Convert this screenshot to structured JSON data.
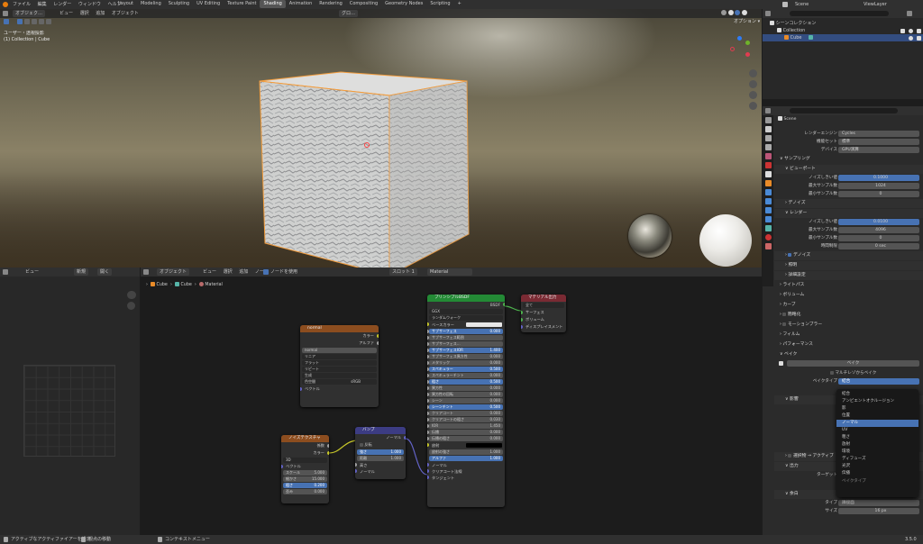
{
  "topbar": {
    "menus": [
      "ファイル",
      "編集",
      "レンダー",
      "ウィンドウ",
      "ヘルプ"
    ],
    "workspaces": [
      "Layout",
      "Modeling",
      "Sculpting",
      "UV Editing",
      "Texture Paint",
      "Shading",
      "Animation",
      "Rendering",
      "Compositing",
      "Geometry Nodes",
      "Scripting"
    ],
    "active_workspace": "Shading",
    "scene": "Scene",
    "view_layer": "ViewLayer"
  },
  "viewport": {
    "mode": "オブジェク…",
    "menus": [
      "ビュー",
      "選択",
      "追加",
      "オブジェクト"
    ],
    "transform": "グロ…",
    "overlay_label": "オプション ▾",
    "info_line1": "ユーザー・透視投影",
    "info_line2": "(1) Collection | Cube"
  },
  "image_editor": {
    "view": "ビュー",
    "new_label": "新規",
    "open_label": "開く"
  },
  "node_editor": {
    "mode": "オブジェクト",
    "menus": [
      "ビュー",
      "選択",
      "追加",
      "ノード"
    ],
    "use_nodes": "ノードを使用",
    "slot": "スロット 1",
    "material": "Material",
    "breadcrumb": [
      "Cube",
      "Cube",
      "Material"
    ]
  },
  "nodes": {
    "normal": {
      "title": "normal",
      "out_color": "カラー",
      "out_alpha": "アルファ",
      "image_name": "normal",
      "interp": "リニア",
      "proj": "フラット",
      "ext": "リピート",
      "source": "生成",
      "cs_label": "色空間",
      "cs_value": "sRGB",
      "vector": "ベクトル"
    },
    "noise": {
      "title": "ノイズテクスチャ",
      "out_fac": "係数",
      "out_color": "カラー",
      "dim": "3D",
      "vector": "ベクトル",
      "fields": [
        {
          "label": "スケール",
          "value": "5.000"
        },
        {
          "label": "細かさ",
          "value": "15.000"
        },
        {
          "label": "粗さ",
          "value": "0.200"
        },
        {
          "label": "歪み",
          "value": "0.000"
        }
      ]
    },
    "bump": {
      "title": "バンプ",
      "out_normal": "ノーマル",
      "invert": "反転",
      "fields": [
        {
          "label": "強さ",
          "value": "1.000"
        },
        {
          "label": "距離",
          "value": "1.000"
        }
      ],
      "height": "高さ",
      "normal_in": "ノーマル"
    },
    "principled": {
      "title": "プリンシプルBSDF",
      "out_bsdf": "BSDF",
      "dist": "GGX",
      "ss_method": "ランダムウォーク",
      "base_color": "ベースカラー",
      "rows": [
        {
          "label": "サブサーフェス",
          "value": "0.000",
          "hl": true
        },
        {
          "label": "サブサーフェス範囲",
          "value": "",
          "hl": false
        },
        {
          "label": "サブサーフェス…",
          "value": "",
          "hl": false
        },
        {
          "label": "サブサーフェスIOR",
          "value": "1.400",
          "hl": true
        },
        {
          "label": "サブサーフェス異方性",
          "value": "0.000",
          "hl": false
        },
        {
          "label": "メタリック",
          "value": "0.000",
          "hl": false
        },
        {
          "label": "スペキュラー",
          "value": "0.500",
          "hl": true
        },
        {
          "label": "スペキュラーチント",
          "value": "0.000",
          "hl": false
        },
        {
          "label": "粗さ",
          "value": "0.500",
          "hl": true
        },
        {
          "label": "異方性",
          "value": "0.000",
          "hl": false
        },
        {
          "label": "異方性の回転",
          "value": "0.000",
          "hl": false
        },
        {
          "label": "シーン",
          "value": "0.000",
          "hl": false
        },
        {
          "label": "シーンチント",
          "value": "0.500",
          "hl": true
        },
        {
          "label": "クリアコート",
          "value": "0.000",
          "hl": false
        },
        {
          "label": "クリアコートの粗さ",
          "value": "0.030",
          "hl": false
        },
        {
          "label": "IOR",
          "value": "1.450",
          "hl": false
        },
        {
          "label": "伝播",
          "value": "0.000",
          "hl": false
        },
        {
          "label": "伝播の粗さ",
          "value": "0.000",
          "hl": false
        }
      ],
      "emission": "放射",
      "emission_strength": {
        "label": "放射の強さ",
        "value": "1.000"
      },
      "alpha": {
        "label": "アルファ",
        "value": "1.000"
      },
      "inputs_bottom": [
        "ノーマル",
        "クリアコート法線",
        "タンジェント"
      ]
    },
    "output": {
      "title": "マテリアル出力",
      "target": "全て",
      "inputs": [
        "サーフェス",
        "ボリューム",
        "ディスプレイスメント"
      ]
    }
  },
  "outliner": {
    "root": "シーンコレクション",
    "collection": "Collection",
    "object": "Cube"
  },
  "properties": {
    "scene_label": "Scene",
    "render_engine": {
      "label": "レンダーエンジン",
      "value": "Cycles"
    },
    "feature_set": {
      "label": "機能セット",
      "value": "標準"
    },
    "device": {
      "label": "デバイス",
      "value": "GPU演算"
    },
    "sampling": "サンプリング",
    "viewport": "ビューポート",
    "vp_noise": {
      "label": "ノイズしきい値",
      "value": "0.1000"
    },
    "vp_max": {
      "label": "最大サンプル数",
      "value": "1024"
    },
    "vp_min": {
      "label": "最小サンプル数",
      "value": "0"
    },
    "denoise": "デノイズ",
    "render": "レンダー",
    "r_noise": {
      "label": "ノイズしきい値",
      "value": "0.0100"
    },
    "r_max": {
      "label": "最大サンプル数",
      "value": "4096"
    },
    "r_min": {
      "label": "最小サンプル数",
      "value": "0"
    },
    "r_time": {
      "label": "時間制限",
      "value": "0 sec"
    },
    "r_denoise": "デノイズ",
    "sections": [
      "照明",
      "詳細設定",
      "ライトパス",
      "ボリューム",
      "カーブ",
      "簡略化",
      "モーションブラー",
      "フィルム",
      "パフォーマンス",
      "ベイク"
    ],
    "bake_button": "ベイク",
    "multires": "マルチレゾからベイク",
    "bake_type_label": "ベイクタイプ",
    "bake_type_value": "結合",
    "influence": "影響",
    "selected_to_active": "選択物 → アクティブ",
    "output": "出力",
    "target_label": "ターゲット",
    "margin": "余白",
    "margin_type": {
      "label": "タイプ",
      "value": "隣接面"
    },
    "margin_size": {
      "label": "サイズ",
      "value": "16 px"
    }
  },
  "bake_dropdown": {
    "items": [
      "結合",
      "アンビエントオクルージョン",
      "影",
      "位置",
      "ノーマル",
      "UV",
      "粗さ",
      "放射",
      "環境",
      "ディフューズ",
      "光沢",
      "伝播"
    ],
    "selected": "ノーマル",
    "footer": "ベイクタイプ"
  },
  "statusbar": {
    "items": [
      "アクティブなアクティファイアーを設定",
      "視点の移動",
      "コンテキストメニュー"
    ],
    "version": "3.5.0"
  }
}
